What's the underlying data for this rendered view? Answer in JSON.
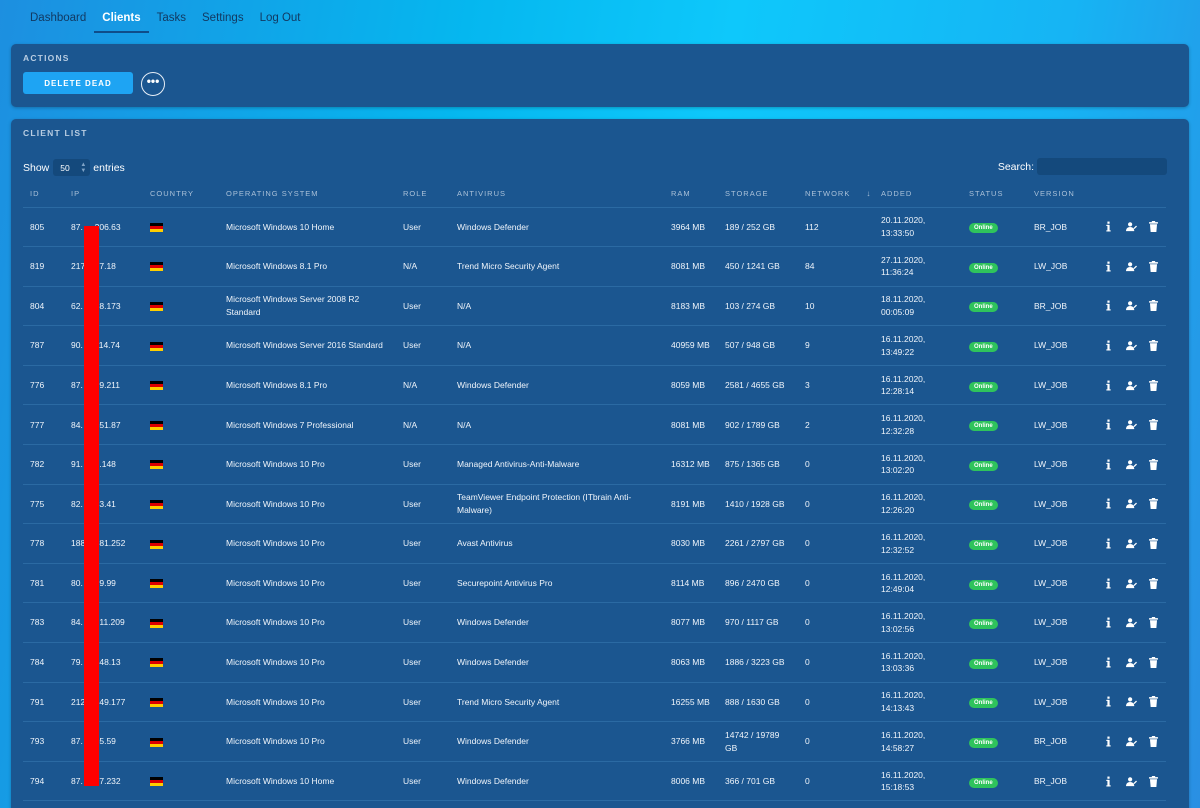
{
  "nav": {
    "items": [
      {
        "label": "Dashboard",
        "active": false
      },
      {
        "label": "Clients",
        "active": true
      },
      {
        "label": "Tasks",
        "active": false
      },
      {
        "label": "Settings",
        "active": false
      },
      {
        "label": "Log Out",
        "active": false
      }
    ]
  },
  "actions": {
    "title": "ACTIONS",
    "delete_dead_label": "DELETE DEAD",
    "more_label": "•••"
  },
  "client_list": {
    "title": "CLIENT LIST",
    "show_label": "Show",
    "entries_value": "50",
    "entries_label": "entries",
    "search_label": "Search:",
    "search_value": "",
    "columns": [
      "ID",
      "IP",
      "COUNTRY",
      "OPERATING SYSTEM",
      "ROLE",
      "ANTIVIRUS",
      "RAM",
      "STORAGE",
      "NETWORK",
      "ADDED",
      "STATUS",
      "VERSION"
    ],
    "sort_indicator": "↓",
    "rows": [
      {
        "id": "805",
        "ip": "87.     206.63",
        "country": "flag-de",
        "os": "Microsoft Windows 10 Home",
        "role": "User",
        "antivirus": "Windows Defender",
        "ram": "3964 MB",
        "storage": "189 / 252 GB",
        "network": "112",
        "added_date": "20.11.2020,",
        "added_time": "13:33:50",
        "status": "Online",
        "version": "BR_JOB"
      },
      {
        "id": "819",
        "ip": "217.     7.18",
        "country": "flag-de",
        "os": "Microsoft Windows 8.1 Pro",
        "role": "N/A",
        "antivirus": "Trend Micro Security Agent",
        "ram": "8081 MB",
        "storage": "450 / 1241 GB",
        "network": "84",
        "added_date": "27.11.2020,",
        "added_time": "11:36:24",
        "status": "Online",
        "version": "LW_JOB"
      },
      {
        "id": "804",
        "ip": "62.     98.173",
        "country": "flag-de",
        "os": "Microsoft Windows Server 2008 R2 Standard",
        "role": "User",
        "antivirus": "N/A",
        "ram": "8183 MB",
        "storage": "103 / 274 GB",
        "network": "10",
        "added_date": "18.11.2020,",
        "added_time": "00:05:09",
        "status": "Online",
        "version": "BR_JOB"
      },
      {
        "id": "787",
        "ip": "90.     114.74",
        "country": "flag-de",
        "os": "Microsoft Windows Server 2016 Standard",
        "role": "User",
        "antivirus": "N/A",
        "ram": "40959 MB",
        "storage": "507 / 948 GB",
        "network": "9",
        "added_date": "16.11.2020,",
        "added_time": "13:49:22",
        "status": "Online",
        "version": "LW_JOB"
      },
      {
        "id": "776",
        "ip": "87.     89.211",
        "country": "flag-de",
        "os": "Microsoft Windows 8.1 Pro",
        "role": "N/A",
        "antivirus": "Windows Defender",
        "ram": "8059 MB",
        "storage": "2581 / 4655 GB",
        "network": "3",
        "added_date": "16.11.2020,",
        "added_time": "12:28:14",
        "status": "Online",
        "version": "LW_JOB"
      },
      {
        "id": "777",
        "ip": "84.     251.87",
        "country": "flag-de",
        "os": "Microsoft Windows 7 Professional",
        "role": "N/A",
        "antivirus": "N/A",
        "ram": "8081 MB",
        "storage": "902 / 1789 GB",
        "network": "2",
        "added_date": "16.11.2020,",
        "added_time": "12:32:28",
        "status": "Online",
        "version": "LW_JOB"
      },
      {
        "id": "782",
        "ip": "91.     0.148",
        "country": "flag-de",
        "os": "Microsoft Windows 10 Pro",
        "role": "User",
        "antivirus": "Managed Antivirus-Anti-Malware",
        "ram": "16312 MB",
        "storage": "875 / 1365 GB",
        "network": "0",
        "added_date": "16.11.2020,",
        "added_time": "13:02:20",
        "status": "Online",
        "version": "LW_JOB"
      },
      {
        "id": "775",
        "ip": "82.     33.41",
        "country": "flag-de",
        "os": "Microsoft Windows 10 Pro",
        "role": "User",
        "antivirus": "TeamViewer Endpoint Protection (ITbrain Anti-Malware)",
        "ram": "8191 MB",
        "storage": "1410 / 1928 GB",
        "network": "0",
        "added_date": "16.11.2020,",
        "added_time": "12:26:20",
        "status": "Online",
        "version": "LW_JOB"
      },
      {
        "id": "778",
        "ip": "188.     81.252",
        "country": "flag-de",
        "os": "Microsoft Windows 10 Pro",
        "role": "User",
        "antivirus": "Avast Antivirus",
        "ram": "8030 MB",
        "storage": "2261 / 2797 GB",
        "network": "0",
        "added_date": "16.11.2020,",
        "added_time": "12:32:52",
        "status": "Online",
        "version": "LW_JOB"
      },
      {
        "id": "781",
        "ip": "80.     89.99",
        "country": "flag-de",
        "os": "Microsoft Windows 10 Pro",
        "role": "User",
        "antivirus": "Securepoint Antivirus Pro",
        "ram": "8114 MB",
        "storage": "896 / 2470 GB",
        "network": "0",
        "added_date": "16.11.2020,",
        "added_time": "12:49:04",
        "status": "Online",
        "version": "LW_JOB"
      },
      {
        "id": "783",
        "ip": "84.     211.209",
        "country": "flag-de",
        "os": "Microsoft Windows 10 Pro",
        "role": "User",
        "antivirus": "Windows Defender",
        "ram": "8077 MB",
        "storage": "970 / 1117 GB",
        "network": "0",
        "added_date": "16.11.2020,",
        "added_time": "13:02:56",
        "status": "Online",
        "version": "LW_JOB"
      },
      {
        "id": "784",
        "ip": "79.     248.13",
        "country": "flag-de",
        "os": "Microsoft Windows 10 Pro",
        "role": "User",
        "antivirus": "Windows Defender",
        "ram": "8063 MB",
        "storage": "1886 / 3223 GB",
        "network": "0",
        "added_date": "16.11.2020,",
        "added_time": "13:03:36",
        "status": "Online",
        "version": "LW_JOB"
      },
      {
        "id": "791",
        "ip": "212.     49.177",
        "country": "flag-de",
        "os": "Microsoft Windows 10 Pro",
        "role": "User",
        "antivirus": "Trend Micro Security Agent",
        "ram": "16255 MB",
        "storage": "888 / 1630 GB",
        "network": "0",
        "added_date": "16.11.2020,",
        "added_time": "14:13:43",
        "status": "Online",
        "version": "LW_JOB"
      },
      {
        "id": "793",
        "ip": "87.     55.59",
        "country": "flag-de",
        "os": "Microsoft Windows 10 Pro",
        "role": "User",
        "antivirus": "Windows Defender",
        "ram": "3766 MB",
        "storage": "14742 / 19789 GB",
        "network": "0",
        "added_date": "16.11.2020,",
        "added_time": "14:58:27",
        "status": "Online",
        "version": "BR_JOB"
      },
      {
        "id": "794",
        "ip": "87.     57.232",
        "country": "flag-de",
        "os": "Microsoft Windows 10 Home",
        "role": "User",
        "antivirus": "Windows Defender",
        "ram": "8006 MB",
        "storage": "366 / 701 GB",
        "network": "0",
        "added_date": "16.11.2020,",
        "added_time": "15:18:53",
        "status": "Online",
        "version": "BR_JOB"
      }
    ]
  }
}
